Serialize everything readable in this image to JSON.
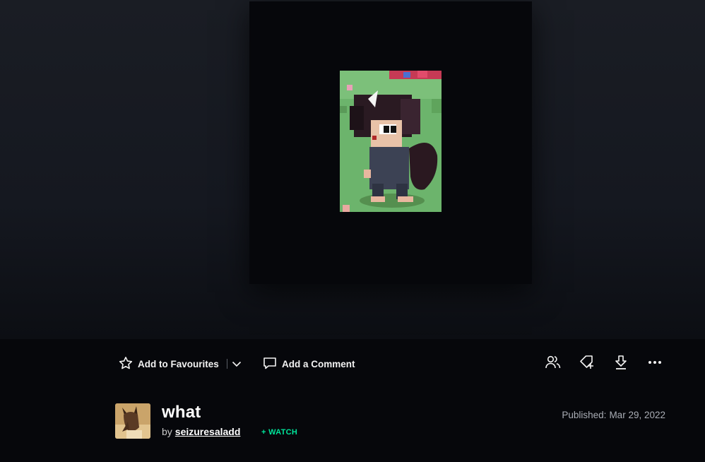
{
  "deviation": {
    "title": "what",
    "by_label": "by",
    "author": "seizuresaladd",
    "watch_label": "+ WATCH",
    "published_label": "Published:",
    "published_date": "Mar 29, 2022"
  },
  "toolbar": {
    "favourite_label": "Add to Favourites",
    "comment_label": "Add a Comment",
    "icons": [
      "star-icon",
      "chevron-down-icon",
      "comment-icon",
      "group-icon",
      "tag-add-icon",
      "download-icon",
      "more-icon"
    ]
  },
  "colors": {
    "background": "#06070b",
    "watch_accent": "#00e59b",
    "muted_text": "#a9adb5"
  }
}
